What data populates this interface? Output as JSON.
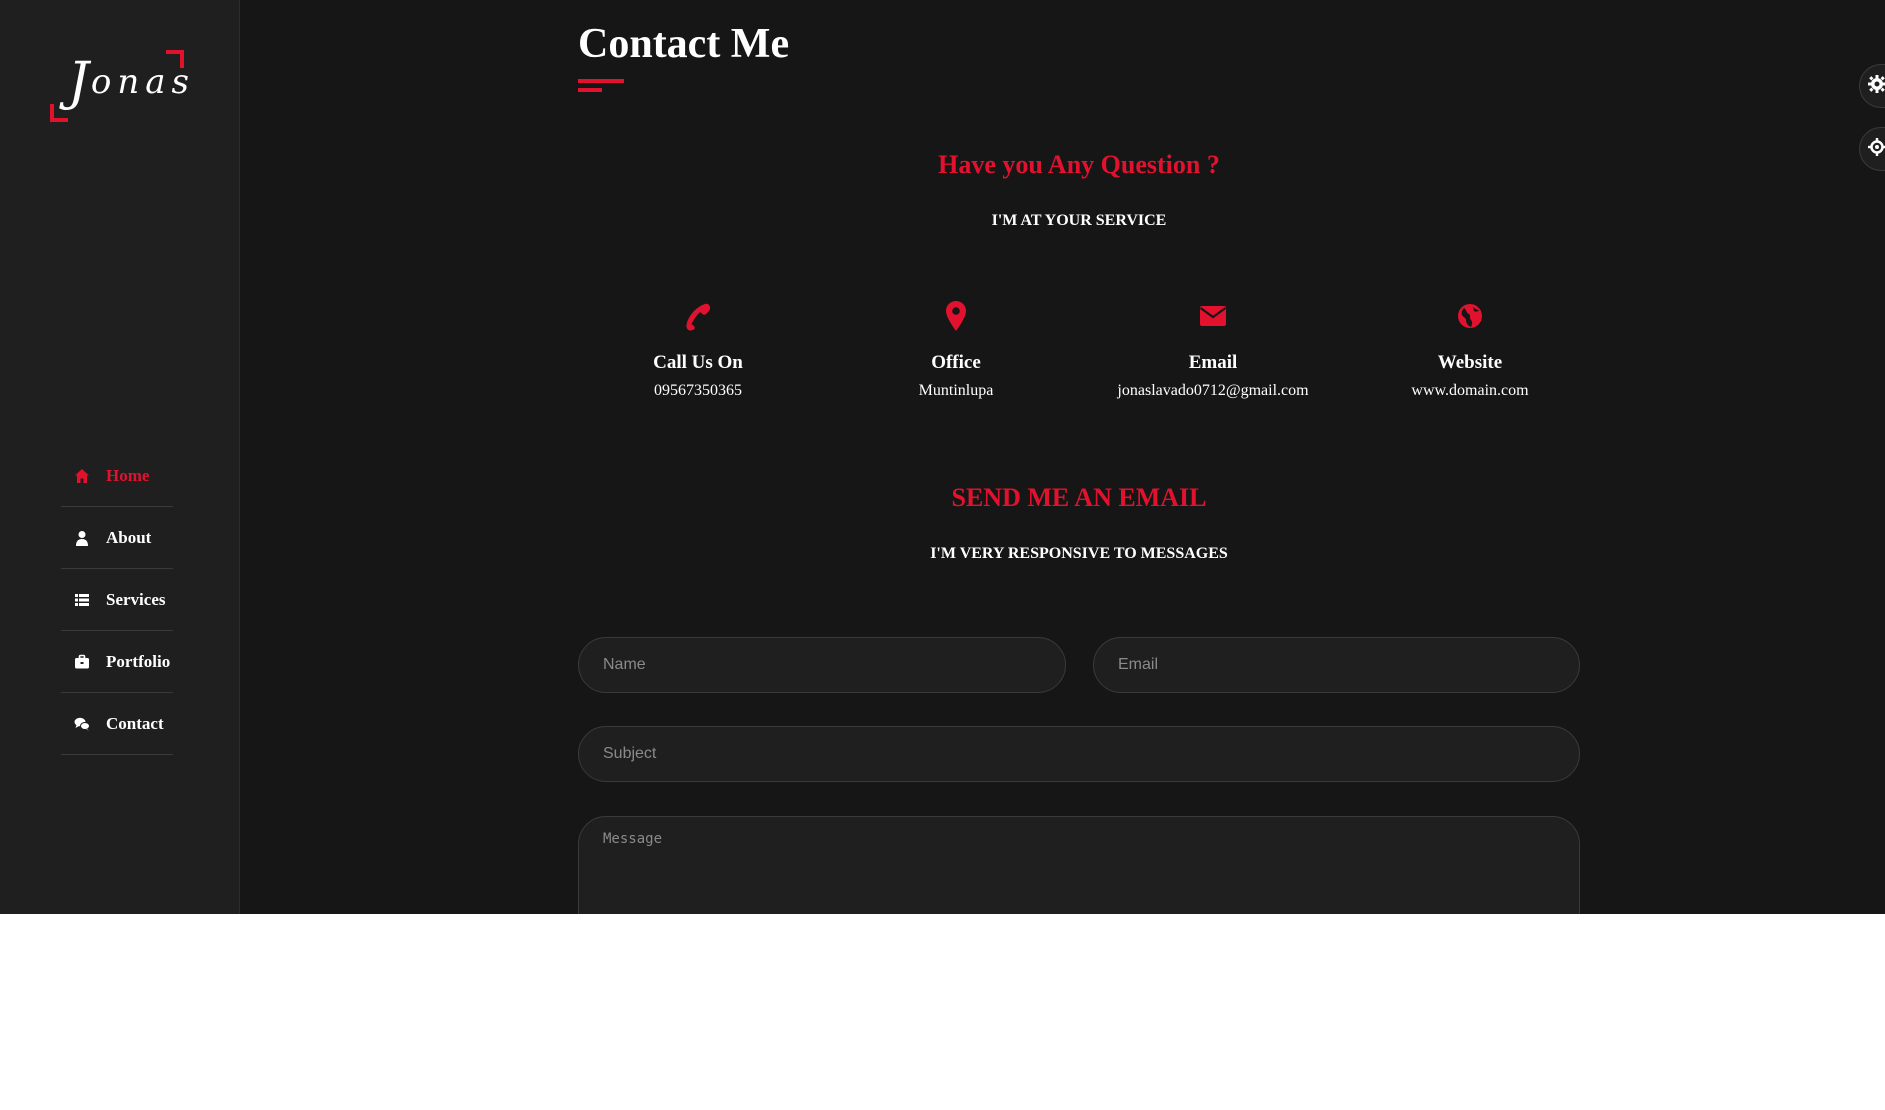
{
  "brand": {
    "logo_text_cap": "J",
    "logo_text_rest": "onas",
    "accent_color": "#e2122f",
    "bg_color": "#161616",
    "sidebar_color": "#1f1f1f"
  },
  "sidebar": {
    "items": [
      {
        "label": "Home",
        "icon": "home-icon",
        "active": true
      },
      {
        "label": "About",
        "icon": "user-icon",
        "active": false
      },
      {
        "label": "Services",
        "icon": "list-icon",
        "active": false
      },
      {
        "label": "Portfolio",
        "icon": "briefcase-icon",
        "active": false
      },
      {
        "label": "Contact",
        "icon": "comments-icon",
        "active": false
      }
    ]
  },
  "page": {
    "title": "Contact Me"
  },
  "question": {
    "heading": "Have you Any Question ?",
    "subheading": "I'M AT YOUR SERVICE"
  },
  "info": [
    {
      "title": "Call Us On",
      "value": "09567350365",
      "icon": "phone-icon"
    },
    {
      "title": "Office",
      "value": "Muntinlupa",
      "icon": "map-marker-icon"
    },
    {
      "title": "Email",
      "value": "jonaslavado0712@gmail.com",
      "icon": "envelope-icon"
    },
    {
      "title": "Website",
      "value": "www.domain.com",
      "icon": "globe-icon"
    }
  ],
  "email_section": {
    "heading": "SEND ME AN EMAIL",
    "subheading": "I'M VERY RESPONSIVE TO MESSAGES"
  },
  "form": {
    "name_placeholder": "Name",
    "email_placeholder": "Email",
    "subject_placeholder": "Subject",
    "message_placeholder": "Message"
  },
  "side_tabs": [
    {
      "icon": "gear-icon"
    },
    {
      "icon": "settings-icon"
    }
  ]
}
